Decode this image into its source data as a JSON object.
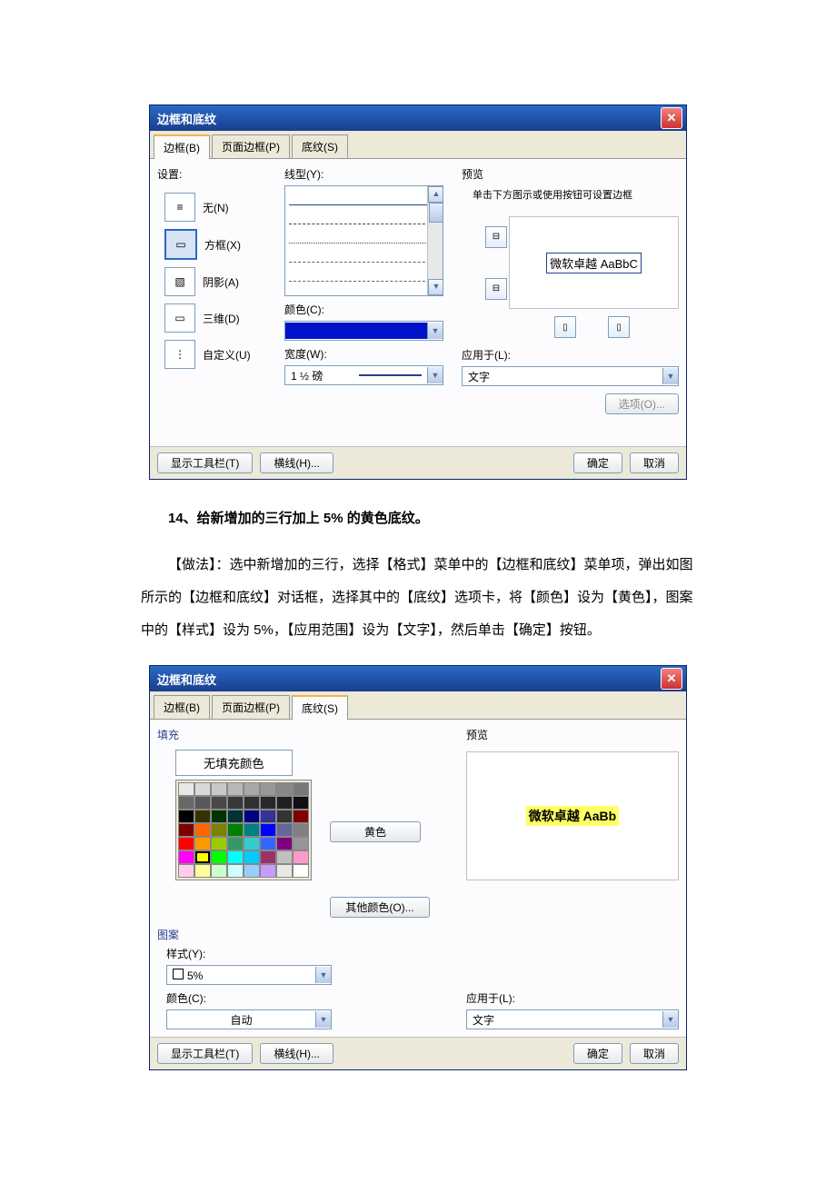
{
  "dialog1": {
    "title": "边框和底纹",
    "tabs": {
      "border": "边框(B)",
      "page": "页面边框(P)",
      "shading": "底纹(S)"
    },
    "settings": {
      "label": "设置:",
      "none": "无(N)",
      "box": "方框(X)",
      "shadow": "阴影(A)",
      "three_d": "三维(D)",
      "custom": "自定义(U)"
    },
    "style": {
      "label": "线型(Y):"
    },
    "color": {
      "label": "颜色(C):"
    },
    "width": {
      "label": "宽度(W):",
      "value": "1 ½ 磅"
    },
    "preview": {
      "label": "预览",
      "hint": "单击下方图示或使用按钮可设置边框",
      "sample": "微软卓越  AaBbC"
    },
    "apply": {
      "label": "应用于(L):",
      "value": "文字"
    },
    "options": "选项(O)...",
    "toolbar": "显示工具栏(T)",
    "hline": "横线(H)...",
    "ok": "确定",
    "cancel": "取消"
  },
  "prose": {
    "line1": "14、给新增加的三行加上 5% 的黄色底纹。",
    "line2": "【做法】：选中新增加的三行，选择【格式】菜单中的【边框和底纹】菜单项，弹出如图所示的【边框和底纹】对话框，选择其中的【底纹】选项卡，将【颜色】设为【黄色】，图案中的【样式】设为 5%，【应用范围】设为【文字】，然后单击【确定】按钮。"
  },
  "dialog2": {
    "title": "边框和底纹",
    "tabs": {
      "border": "边框(B)",
      "page": "页面边框(P)",
      "shading": "底纹(S)"
    },
    "fill": {
      "label": "填充",
      "nofill": "无填充颜色",
      "color_name": "黄色",
      "other": "其他颜色(O)..."
    },
    "pattern": {
      "label": "图案",
      "style_label": "样式(Y):",
      "style_value": "5%",
      "color_label": "颜色(C):",
      "color_value": "自动"
    },
    "preview": {
      "label": "预览",
      "sample": "微软卓越   AaBb"
    },
    "apply": {
      "label": "应用于(L):",
      "value": "文字"
    },
    "toolbar": "显示工具栏(T)",
    "hline": "横线(H)...",
    "ok": "确定",
    "cancel": "取消"
  },
  "palette_colors": [
    [
      "#e8e8e8",
      "#d8d8d8",
      "#c8c8c8",
      "#b8b8b8",
      "#a8a8a8",
      "#989898",
      "#888888",
      "#787878"
    ],
    [
      "#686868",
      "#585858",
      "#484848",
      "#383838",
      "#303030",
      "#282828",
      "#202020",
      "#101010"
    ],
    [
      "#000000",
      "#333300",
      "#003300",
      "#003333",
      "#000080",
      "#333399",
      "#333333",
      "#800000"
    ],
    [
      "#800000",
      "#ff6600",
      "#808000",
      "#008000",
      "#008080",
      "#0000ff",
      "#666699",
      "#808080"
    ],
    [
      "#ff0000",
      "#ff9900",
      "#99cc00",
      "#339966",
      "#33cccc",
      "#3366ff",
      "#800080",
      "#969696"
    ],
    [
      "#ff00ff",
      "#ffff00",
      "#00ff00",
      "#00ffff",
      "#00ccff",
      "#993366",
      "#c0c0c0",
      "#ff99cc"
    ],
    [
      "#ffccee",
      "#ffff99",
      "#ccffcc",
      "#ccffff",
      "#99ccff",
      "#cc99ff",
      "#e8e8e8",
      "#ffffff"
    ]
  ]
}
